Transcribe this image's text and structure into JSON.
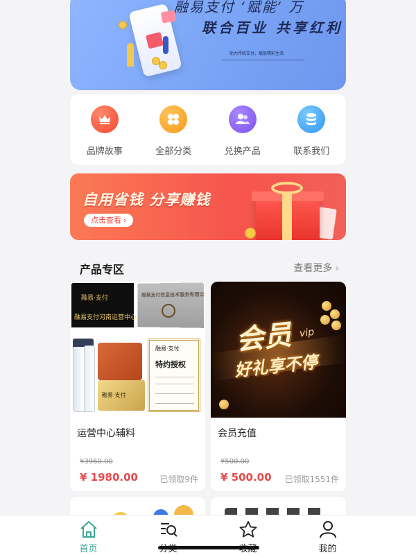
{
  "hero": {
    "slogan_top": "融易支付 ‘赋能’ 万",
    "slogan_main": "联合百业 共享红利",
    "slogan_small": "助力传统支付，赋能精彩生活"
  },
  "quick_nav": [
    {
      "label": "品牌故事",
      "icon": "crown-icon",
      "color": "#f4563e"
    },
    {
      "label": "全部分类",
      "icon": "grid-icon",
      "color": "#f7a323"
    },
    {
      "label": "兑换产品",
      "icon": "users-icon",
      "color": "#8b5cf0"
    },
    {
      "label": "联系我们",
      "icon": "database-icon",
      "color": "#3aa4f2"
    }
  ],
  "promo": {
    "title": "自用省钱 分享赚钱",
    "button": "点击查看",
    "button_arrow": "›"
  },
  "section": {
    "title": "产品专区",
    "more": "查看更多",
    "more_chevron": "›"
  },
  "products": [
    {
      "name": "运营中心辅料",
      "original_price": "¥3960.00",
      "price": "¥ 1980.00",
      "claimed": "已领取9件",
      "image": {
        "plaque_top": "融易·支付",
        "plaque_bottom": "融易支付河南运营中心",
        "silver_text": "融易支付信息技术服务有限公司",
        "gold_card_text": "融易·支付",
        "cert_head": "融易·支付",
        "cert_title": "特约授权"
      }
    },
    {
      "name": "会员充值",
      "original_price": "¥500.00",
      "price": "¥ 500.00",
      "claimed": "已领取1551件",
      "image": {
        "big": "会员",
        "tag": "vip",
        "sub": "好礼享不停"
      }
    }
  ],
  "tab_bar": [
    {
      "label": "首页",
      "icon": "home-icon",
      "active": true
    },
    {
      "label": "分类",
      "icon": "category-search-icon",
      "active": false
    },
    {
      "label": "收藏",
      "icon": "star-icon",
      "active": false
    },
    {
      "label": "我的",
      "icon": "profile-icon",
      "active": false
    }
  ],
  "colors": {
    "accent": "#3aa895",
    "price": "#e84a4a",
    "promo": "#f6544c"
  }
}
